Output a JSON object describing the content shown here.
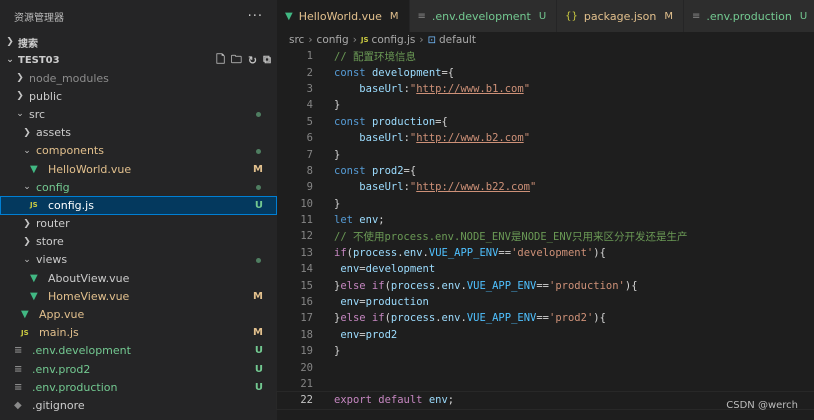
{
  "sidebar": {
    "title": "资源管理器",
    "more": "···",
    "search_section": "搜索",
    "project": "TEST03",
    "items": [
      {
        "label": "node_modules",
        "indent": 1,
        "kind": "folder",
        "open": false,
        "color": "dim",
        "status": ""
      },
      {
        "label": "public",
        "indent": 1,
        "kind": "folder",
        "open": false,
        "color": "norm",
        "status": ""
      },
      {
        "label": "src",
        "indent": 1,
        "kind": "folder",
        "open": true,
        "color": "norm",
        "status": "dot"
      },
      {
        "label": "assets",
        "indent": 2,
        "kind": "folder",
        "open": false,
        "color": "norm",
        "status": ""
      },
      {
        "label": "components",
        "indent": 2,
        "kind": "folder",
        "open": true,
        "color": "mod",
        "status": "dot"
      },
      {
        "label": "HelloWorld.vue",
        "indent": 3,
        "kind": "vue",
        "color": "mod",
        "status": "M"
      },
      {
        "label": "config",
        "indent": 2,
        "kind": "folder",
        "open": true,
        "color": "new",
        "status": "dot"
      },
      {
        "label": "config.js",
        "indent": 3,
        "kind": "js",
        "color": "norm",
        "status": "U",
        "selected": true
      },
      {
        "label": "router",
        "indent": 2,
        "kind": "folder",
        "open": false,
        "color": "norm",
        "status": ""
      },
      {
        "label": "store",
        "indent": 2,
        "kind": "folder",
        "open": false,
        "color": "norm",
        "status": ""
      },
      {
        "label": "views",
        "indent": 2,
        "kind": "folder",
        "open": true,
        "color": "norm",
        "status": "dot"
      },
      {
        "label": "AboutView.vue",
        "indent": 3,
        "kind": "vue",
        "color": "norm",
        "status": ""
      },
      {
        "label": "HomeView.vue",
        "indent": 3,
        "kind": "vue",
        "color": "mod",
        "status": "M"
      },
      {
        "label": "App.vue",
        "indent": 2,
        "kind": "vue",
        "color": "mod",
        "status": ""
      },
      {
        "label": "main.js",
        "indent": 2,
        "kind": "js",
        "color": "mod",
        "status": "M"
      },
      {
        "label": ".env.development",
        "indent": 1,
        "kind": "env",
        "color": "new",
        "status": "U"
      },
      {
        "label": ".env.prod2",
        "indent": 1,
        "kind": "env",
        "color": "new",
        "status": "U"
      },
      {
        "label": ".env.production",
        "indent": 1,
        "kind": "env",
        "color": "new",
        "status": "U"
      },
      {
        "label": ".gitignore",
        "indent": 1,
        "kind": "git",
        "color": "norm",
        "status": ""
      }
    ]
  },
  "tabs": [
    {
      "label": "HelloWorld.vue",
      "icon": "vue-icon",
      "glyph": "▼",
      "status": "M",
      "color": "mod",
      "active": true
    },
    {
      "label": ".env.development",
      "icon": "env-file-icon",
      "glyph": "≡",
      "status": "U",
      "color": "new",
      "active": false
    },
    {
      "label": "package.json",
      "icon": "json-icon",
      "glyph": "{}",
      "status": "M",
      "color": "mod",
      "active": false
    },
    {
      "label": ".env.production",
      "icon": "env-file-icon",
      "glyph": "≡",
      "status": "U",
      "color": "new",
      "active": false
    }
  ],
  "breadcrumb": [
    "src",
    "config",
    "config.js",
    "default"
  ],
  "code": [
    {
      "n": "1",
      "tokens": [
        [
          "cmt",
          "// 配置环境信息"
        ]
      ]
    },
    {
      "n": "2",
      "tokens": [
        [
          "kw",
          "const "
        ],
        [
          "var",
          "development"
        ],
        [
          "plain",
          "={"
        ]
      ]
    },
    {
      "n": "3",
      "tokens": [
        [
          "plain",
          "    "
        ],
        [
          "var",
          "baseUrl"
        ],
        [
          "plain",
          ":"
        ],
        [
          "str",
          "\""
        ],
        [
          "url",
          "http://www.b1.com"
        ],
        [
          "str",
          "\""
        ]
      ]
    },
    {
      "n": "4",
      "tokens": [
        [
          "plain",
          "}"
        ]
      ]
    },
    {
      "n": "5",
      "tokens": [
        [
          "kw",
          "const "
        ],
        [
          "var",
          "production"
        ],
        [
          "plain",
          "={"
        ]
      ]
    },
    {
      "n": "6",
      "tokens": [
        [
          "plain",
          "    "
        ],
        [
          "var",
          "baseUrl"
        ],
        [
          "plain",
          ":"
        ],
        [
          "str",
          "\""
        ],
        [
          "url",
          "http://www.b2.com"
        ],
        [
          "str",
          "\""
        ]
      ]
    },
    {
      "n": "7",
      "tokens": [
        [
          "plain",
          "}"
        ]
      ]
    },
    {
      "n": "8",
      "tokens": [
        [
          "kw",
          "const "
        ],
        [
          "var",
          "prod2"
        ],
        [
          "plain",
          "={"
        ]
      ]
    },
    {
      "n": "9",
      "tokens": [
        [
          "plain",
          "    "
        ],
        [
          "var",
          "baseUrl"
        ],
        [
          "plain",
          ":"
        ],
        [
          "str",
          "\""
        ],
        [
          "url",
          "http://www.b22.com"
        ],
        [
          "str",
          "\""
        ]
      ]
    },
    {
      "n": "10",
      "tokens": [
        [
          "plain",
          "}"
        ]
      ]
    },
    {
      "n": "11",
      "tokens": [
        [
          "kw",
          "let "
        ],
        [
          "var",
          "env"
        ],
        [
          "plain",
          ";"
        ]
      ]
    },
    {
      "n": "12",
      "tokens": [
        [
          "cmt",
          "// 不使用process.env.NODE_ENV是NODE_ENV只用来区分开发还是生产"
        ]
      ]
    },
    {
      "n": "13",
      "tokens": [
        [
          "ctl",
          "if"
        ],
        [
          "plain",
          "("
        ],
        [
          "var",
          "process"
        ],
        [
          "plain",
          "."
        ],
        [
          "var",
          "env"
        ],
        [
          "plain",
          "."
        ],
        [
          "cnst",
          "VUE_APP_ENV"
        ],
        [
          "plain",
          "=="
        ],
        [
          "str",
          "'development'"
        ],
        [
          "plain",
          "){"
        ]
      ]
    },
    {
      "n": "14",
      "tokens": [
        [
          "plain",
          " "
        ],
        [
          "var",
          "env"
        ],
        [
          "plain",
          "="
        ],
        [
          "var",
          "development"
        ]
      ]
    },
    {
      "n": "15",
      "tokens": [
        [
          "plain",
          "}"
        ],
        [
          "ctl",
          "else if"
        ],
        [
          "plain",
          "("
        ],
        [
          "var",
          "process"
        ],
        [
          "plain",
          "."
        ],
        [
          "var",
          "env"
        ],
        [
          "plain",
          "."
        ],
        [
          "cnst",
          "VUE_APP_ENV"
        ],
        [
          "plain",
          "=="
        ],
        [
          "str",
          "'production'"
        ],
        [
          "plain",
          "){"
        ]
      ]
    },
    {
      "n": "16",
      "tokens": [
        [
          "plain",
          " "
        ],
        [
          "var",
          "env"
        ],
        [
          "plain",
          "="
        ],
        [
          "var",
          "production"
        ]
      ]
    },
    {
      "n": "17",
      "tokens": [
        [
          "plain",
          "}"
        ],
        [
          "ctl",
          "else if"
        ],
        [
          "plain",
          "("
        ],
        [
          "var",
          "process"
        ],
        [
          "plain",
          "."
        ],
        [
          "var",
          "env"
        ],
        [
          "plain",
          "."
        ],
        [
          "cnst",
          "VUE_APP_ENV"
        ],
        [
          "plain",
          "=="
        ],
        [
          "str",
          "'prod2'"
        ],
        [
          "plain",
          "){"
        ]
      ]
    },
    {
      "n": "18",
      "tokens": [
        [
          "plain",
          " "
        ],
        [
          "var",
          "env"
        ],
        [
          "plain",
          "="
        ],
        [
          "var",
          "prod2"
        ]
      ]
    },
    {
      "n": "19",
      "tokens": [
        [
          "plain",
          "}"
        ]
      ]
    },
    {
      "n": "20",
      "tokens": []
    },
    {
      "n": "21",
      "tokens": []
    },
    {
      "n": "22",
      "tokens": [
        [
          "ctl",
          "export default "
        ],
        [
          "var",
          "env"
        ],
        [
          "plain",
          ";"
        ]
      ],
      "current": true
    }
  ],
  "watermark": "CSDN @werch"
}
